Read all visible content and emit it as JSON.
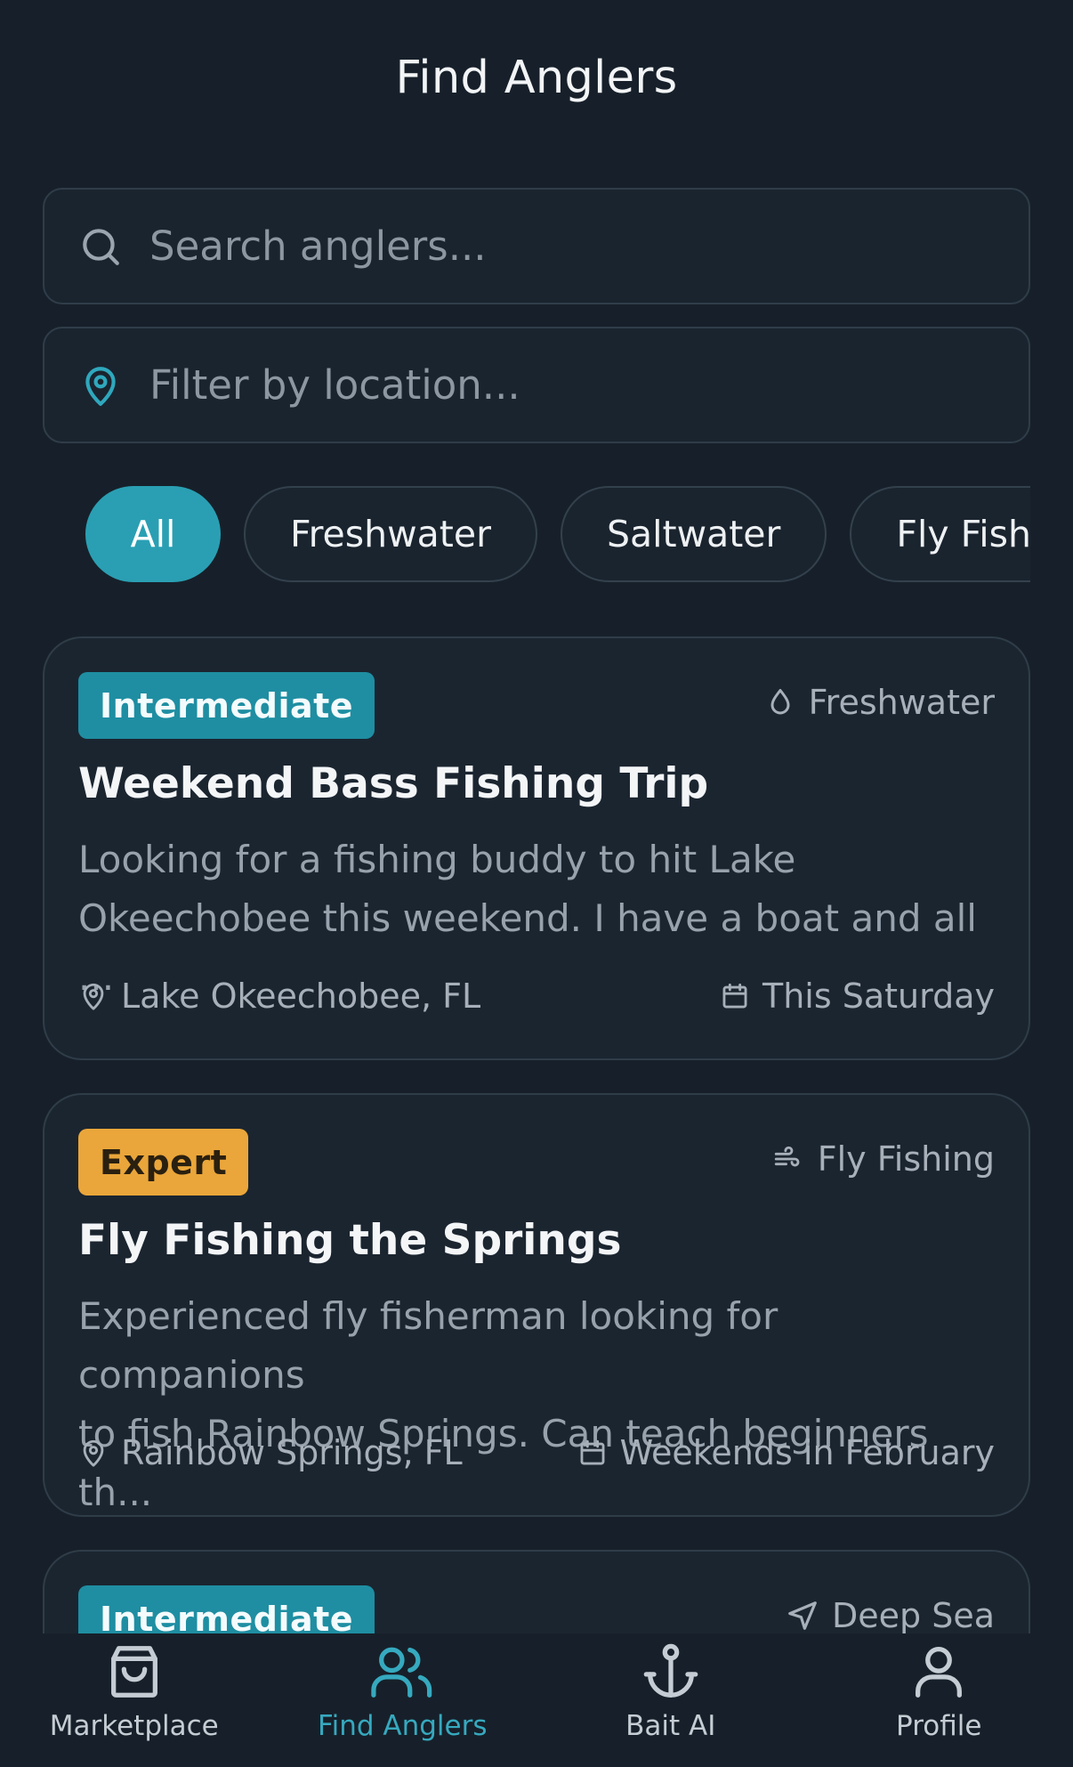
{
  "header": {
    "title": "Find Anglers"
  },
  "search": {
    "placeholder": "Search anglers..."
  },
  "location": {
    "placeholder": "Filter by location..."
  },
  "filters": [
    {
      "label": "All",
      "active": true
    },
    {
      "label": "Freshwater",
      "active": false
    },
    {
      "label": "Saltwater",
      "active": false
    },
    {
      "label": "Fly Fishing",
      "active": false
    }
  ],
  "cards": [
    {
      "level": "Intermediate",
      "type": "Freshwater",
      "type_icon": "water-drop-icon",
      "title": "Weekend Bass Fishing Trip",
      "description_line1": "Looking for a fishing buddy to hit Lake",
      "description_line2": "Okeechobee this weekend. I have a boat and all ...",
      "location": "Lake Okeechobee, FL",
      "date": "This Saturday"
    },
    {
      "level": "Expert",
      "type": "Fly Fishing",
      "type_icon": "wind-icon",
      "title": "Fly Fishing the Springs",
      "description_line1": "Experienced fly fisherman looking for companions",
      "description_line2": "to fish Rainbow Springs. Can teach beginners th...",
      "location": "Rainbow Springs, FL",
      "date": "Weekends in February"
    },
    {
      "level": "Intermediate",
      "type": "Deep Sea",
      "type_icon": "navigation-arrow-icon"
    }
  ],
  "nav": [
    {
      "label": "Marketplace",
      "icon": "shopping-bag-icon",
      "active": false
    },
    {
      "label": "Find Anglers",
      "icon": "users-icon",
      "active": true
    },
    {
      "label": "Bait AI",
      "icon": "anchor-icon",
      "active": false
    },
    {
      "label": "Profile",
      "icon": "user-icon",
      "active": false
    }
  ],
  "colors": {
    "background": "#17202a",
    "accent": "#2a9fb3",
    "intermediate": "#1f8ea2",
    "expert": "#eaa63a"
  }
}
